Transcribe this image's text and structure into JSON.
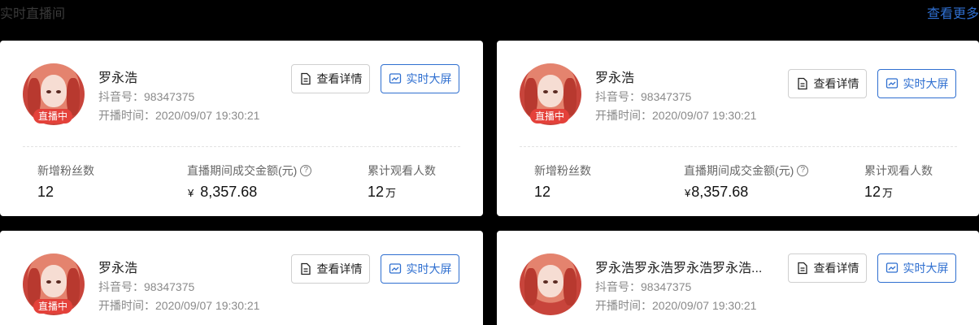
{
  "header": {
    "title": "实时直播间",
    "see_more": "查看更多"
  },
  "cards": [
    {
      "name": "罗永浩",
      "live_badge": "直播中",
      "douyin_id": "抖音号：98347375",
      "start_time": "开播时间：2020/09/07 19:30:21",
      "btn_detail": "查看详情",
      "btn_screen": "实时大屏",
      "stats": {
        "new_fans_label": "新增粉丝数",
        "new_fans_value": "12",
        "gmv_label": "直播期间成交金额(元)",
        "gmv_currency": "¥",
        "gmv_value": "8,357.68",
        "viewers_label": "累计观看人数",
        "viewers_value": "12",
        "viewers_unit": "万",
        "help": "?"
      }
    },
    {
      "name": "罗永浩",
      "live_badge": "直播中",
      "douyin_id": "抖音号：98347375",
      "start_time": "开播时间：2020/09/07 19:30:21",
      "btn_detail": "查看详情",
      "btn_screen": "实时大屏",
      "stats": {
        "new_fans_label": "新增粉丝数",
        "new_fans_value": "12",
        "gmv_label": "直播期间成交金额(元)",
        "gmv_currency": "¥",
        "gmv_value": "8,357.68",
        "viewers_label": "累计观看人数",
        "viewers_value": "12",
        "viewers_unit": "万",
        "help": "?"
      }
    },
    {
      "name": "罗永浩",
      "live_badge": "直播中",
      "douyin_id": "抖音号：98347375",
      "start_time": "开播时间：2020/09/07 19:30:21",
      "btn_detail": "查看详情",
      "btn_screen": "实时大屏"
    },
    {
      "name": "罗永浩罗永浩罗永浩罗永浩...",
      "douyin_id": "抖音号：98347375",
      "start_time": "开播时间：2020/09/07 19:30:21",
      "btn_detail": "查看详情",
      "btn_screen": "实时大屏"
    }
  ]
}
